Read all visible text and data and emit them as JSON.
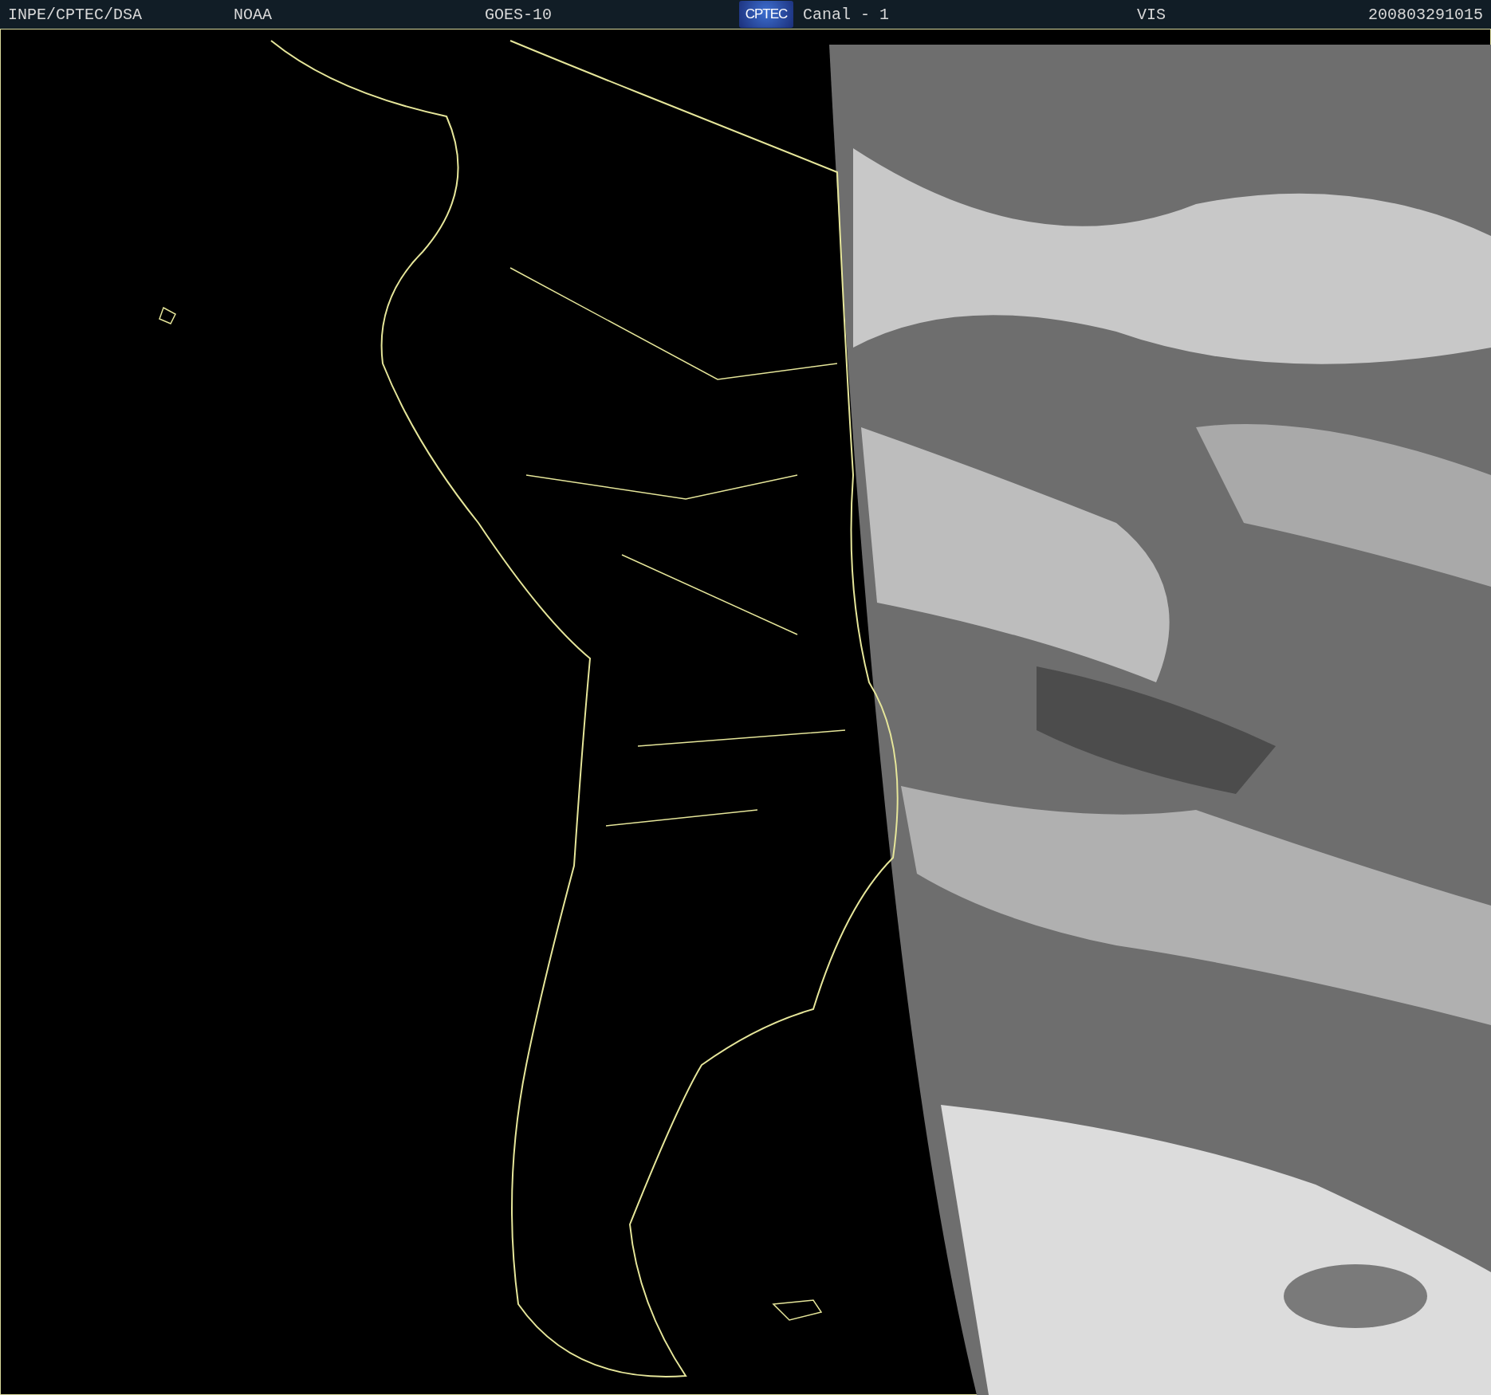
{
  "header": {
    "items": [
      {
        "kind": "text",
        "text": "INPE/CPTEC/DSA"
      },
      {
        "kind": "text",
        "text": "NOAA"
      },
      {
        "kind": "text",
        "text": "GOES-10"
      },
      {
        "kind": "logo",
        "text": "CPTEC"
      },
      {
        "kind": "text",
        "text": "Canal - 1"
      },
      {
        "kind": "text",
        "text": "VIS"
      },
      {
        "kind": "text",
        "text": "200803291015"
      }
    ]
  }
}
